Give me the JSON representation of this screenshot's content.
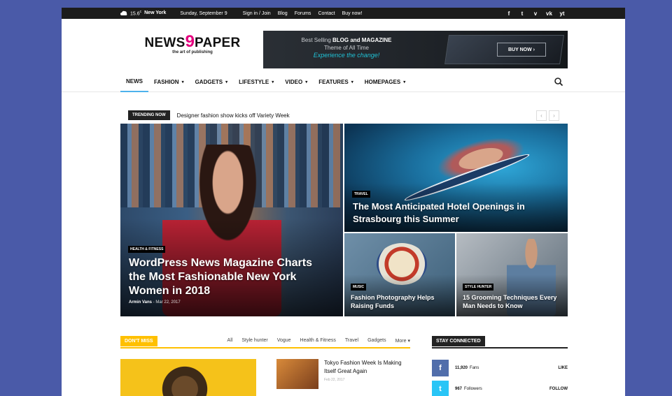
{
  "topbar": {
    "temperature": "15.6",
    "temp_unit": "c",
    "location": "New York",
    "date": "Sunday, September 9",
    "links": [
      "Sign in / Join",
      "Blog",
      "Forums",
      "Contact",
      "Buy now!"
    ],
    "social": [
      "f",
      "t",
      "v",
      "vk",
      "yt"
    ]
  },
  "logo": {
    "left": "NEWS",
    "nine": "9",
    "right": "PAPER",
    "tagline": "the art of publishing"
  },
  "banner": {
    "line1": "Best Selling",
    "line1b": "BLOG and MAGAZINE",
    "line2": "Theme of All Time",
    "line3": "Experience the change!",
    "button": "BUY NOW ›"
  },
  "nav": {
    "items": [
      {
        "label": "NEWS",
        "caret": ""
      },
      {
        "label": "FASHION",
        "caret": "▾"
      },
      {
        "label": "GADGETS",
        "caret": "▾"
      },
      {
        "label": "LIFESTYLE",
        "caret": "▾"
      },
      {
        "label": "VIDEO",
        "caret": "▾"
      },
      {
        "label": "FEATURES",
        "caret": "▾"
      },
      {
        "label": "HOMEPAGES",
        "caret": "▾"
      }
    ]
  },
  "trending": {
    "label": "TRENDING NOW",
    "headline": "Designer fashion show kicks off Variety Week",
    "prev": "‹",
    "next": "›"
  },
  "featured": {
    "big": {
      "category": "HEALTH & FITNESS",
      "title": "WordPress News Magazine Charts the Most Fashionable New York Women in 2018",
      "author": "Armin Vans",
      "date": "Mar 22, 2017"
    },
    "top_right": {
      "category": "TRAVEL",
      "title": "The Most Anticipated Hotel Openings in Strasbourg this Summer"
    },
    "bottom_left": {
      "category": "MUSIC",
      "title": "Fashion Photography Helps Raising Funds"
    },
    "bottom_right": {
      "category": "STYLE HUNTER",
      "title": "15 Grooming Techniques Every Man Needs to Know"
    }
  },
  "dont_miss": {
    "label": "DON'T MISS",
    "tabs": [
      "All",
      "Style hunter",
      "Vogue",
      "Health & Fitness",
      "Travel",
      "Gadgets",
      "More ▾"
    ],
    "side_post": {
      "title": "Tokyo Fashion Week Is Making Itself Great Again",
      "date": "Feb 22, 2017"
    }
  },
  "stay_connected": {
    "label": "STAY CONNECTED",
    "rows": [
      {
        "icon": "f",
        "count": "11,920",
        "unit": "Fans",
        "action": "LIKE",
        "color": "#516eab"
      },
      {
        "icon": "t",
        "count": "967",
        "unit": "Followers",
        "action": "FOLLOW",
        "color": "#29c5f6"
      }
    ]
  },
  "colors": {
    "accent": "#4db2ec",
    "dont_miss": "#ffc000",
    "page_bg": "#4a5aa8"
  }
}
